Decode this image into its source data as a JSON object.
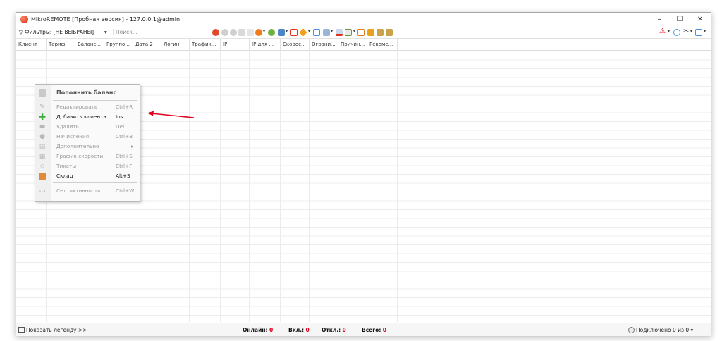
{
  "window": {
    "title": "MikroREMOTE [Пробная версия] - 127.0.0.1@admin",
    "minimize": "–",
    "maximize": "☐",
    "close": "✕"
  },
  "toolbar": {
    "filter_label": "Фильтры: [НЕ ВЫБРАНЫ]",
    "filter_arrow": "▾",
    "search_placeholder": "Поиск...",
    "warning_icon": "warning-icon"
  },
  "grid": {
    "columns": [
      "Клиент",
      "Тариф",
      "Баланс...",
      "Группо...",
      "Дата 2",
      "Логин",
      "Трафик...",
      "IP",
      "IP для ...",
      "Скорос...",
      "Ограни...",
      "Причин...",
      "Рекоме..."
    ]
  },
  "context_menu": {
    "header": "Пополнить баланс",
    "items": [
      {
        "label": "Редактировать",
        "shortcut": "Ctrl+R",
        "icon": "pencil-icon"
      },
      {
        "label": "Добавить клиента",
        "shortcut": "Ins",
        "icon": "plus-icon"
      },
      {
        "label": "Удалить",
        "shortcut": "Del",
        "icon": "minus-icon"
      },
      {
        "label": "Начисления",
        "shortcut": "Ctrl+B",
        "icon": "coin-icon"
      },
      {
        "label": "Дополнительно",
        "shortcut": "▸",
        "icon": "folder-icon"
      },
      {
        "label": "График скорости",
        "shortcut": "Ctrl+S",
        "icon": "chart-icon"
      },
      {
        "label": "Тикеты",
        "shortcut": "Ctrl+F",
        "icon": "ticket-icon"
      },
      {
        "label": "Склад",
        "shortcut": "Alt+S",
        "icon": "box-icon"
      },
      {
        "label": "Сет. активность",
        "shortcut": "Ctrl+W",
        "icon": "monitor-icon"
      }
    ]
  },
  "statusbar": {
    "legend": "Показать легенду >>",
    "online_label": "Онлайн:",
    "online_value": "0",
    "on_label": "Вкл.:",
    "on_value": "0",
    "off_label": "Откл.:",
    "off_value": "0",
    "total_label": "Всего:",
    "total_value": "0",
    "connected": "Подключено 0 из 0 ▾"
  },
  "colors": {
    "accent_red": "#e0001b",
    "green": "#3aa935"
  }
}
